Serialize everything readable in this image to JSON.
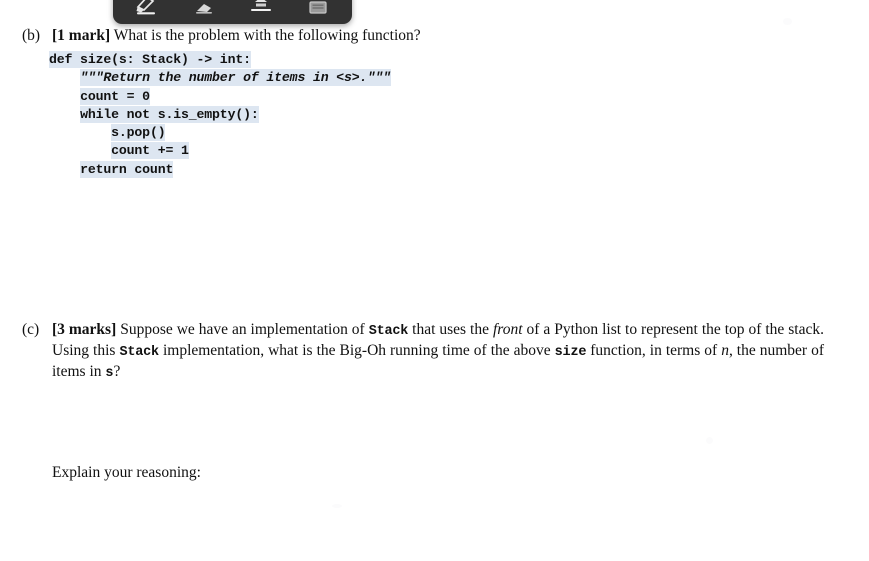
{
  "toolbar": {
    "name": "annotation-toolbar",
    "background_color": "#323232",
    "tools": [
      {
        "id": "highlighter",
        "label": "Highlighter",
        "icon": "highlighter-icon"
      },
      {
        "id": "eraser",
        "label": "Eraser",
        "icon": "eraser-icon"
      },
      {
        "id": "underline",
        "label": "Underline",
        "icon": "underline-icon"
      },
      {
        "id": "note",
        "label": "Sticky Note",
        "icon": "note-icon"
      }
    ]
  },
  "document": {
    "questions": [
      {
        "id": "b",
        "label": "(b)",
        "marks": "[1 mark]",
        "text": " What is the problem with the following function?"
      },
      {
        "id": "c",
        "label": "(c)",
        "marks": "[3 marks]",
        "line1_a": " Suppose we have an implementation of ",
        "line1_mono": "Stack",
        "line1_b": " that uses the ",
        "line1_it": "front",
        "line1_c": " of a Python list to represent",
        "line2_a": "the top of the stack.  Using this ",
        "line2_mono": "Stack",
        "line2_b": " implementation, what is the Big-Oh running time of the above ",
        "line2_mono2": "size",
        "line3_a": "function, in terms of ",
        "line3_var": "n",
        "line3_b": ", the number of items in ",
        "line3_var2": "s",
        "line3_c": "?"
      }
    ],
    "code": {
      "highlight_color": "#dde6f1",
      "lines": [
        "def size(s: Stack) -> int:",
        "    \"\"\"Return the number of items in <s>.\"\"\"",
        "    count = 0",
        "    while not s.is_empty():",
        "        s.pop()",
        "        count += 1",
        "    return count"
      ],
      "line1": "def size(s: Stack) -> int:",
      "line2_indent": "    ",
      "line2": "\"\"\"Return the number of items in <s>.\"\"\"",
      "line3_indent": "    ",
      "line3": "count = 0",
      "line4_indent": "    ",
      "line4": "while not s.is_empty():",
      "line5_indent": "        ",
      "line5": "s.pop()",
      "line6_indent": "        ",
      "line6": "count += 1",
      "line7_indent": "    ",
      "line7": "return count"
    },
    "explain_prompt": "Explain your reasoning:"
  }
}
